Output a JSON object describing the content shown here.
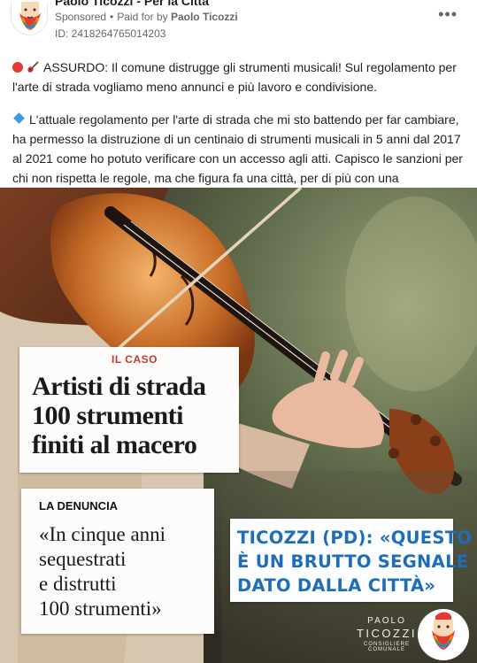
{
  "post": {
    "page_name": "Paolo Ticozzi - Per la Città",
    "sponsored": "Sponsored",
    "paid_for_prefix": "Paid for by",
    "paid_for_by": "Paolo Ticozzi",
    "ad_id": "ID: 2418264765014203",
    "more_icon": "more-horizontal-icon",
    "text_p1": "ASSURDO: Il comune distrugge gli strumenti musicali! Sul regolamento per l'arte di strada vogliamo meno annunci e più lavoro e condivisione.",
    "text_p2": "L'attuale regolamento per l'arte di strada che mi sto battendo per far cambiare, ha permesso la distruzione di un centinaio di strumenti musicali in 5 anni dal 2017 al 2021 come ho potuto verificare con un accesso agli atti. Capisco le sanzioni per chi non rispetta le regole, ma che figura fa una città, per di più con una vocazione…"
  },
  "image": {
    "clip1": {
      "kicker": "IL CASO",
      "lines": [
        "Artisti di strada",
        "100 strumenti",
        "finiti al macero"
      ]
    },
    "clip2": {
      "kicker": "LA DENUNCIA",
      "lines": [
        "«In cinque anni",
        "sequestrati",
        "e distrutti",
        "100 strumenti»"
      ]
    },
    "clip3": {
      "lines": [
        "TICOZZI (PD): «QUESTO",
        "È UN BRUTTO SEGNALE",
        "DATO DALLA CITTÀ»"
      ]
    },
    "logo": {
      "line1": "PAOLO",
      "line2": "TICOZZI",
      "line3": "CONSIGLIERE COMUNALE"
    }
  },
  "colors": {
    "clip_kicker_red": "#c0392b",
    "clip3_blue": "#1f6cb8",
    "meta_gray": "#65676b"
  }
}
